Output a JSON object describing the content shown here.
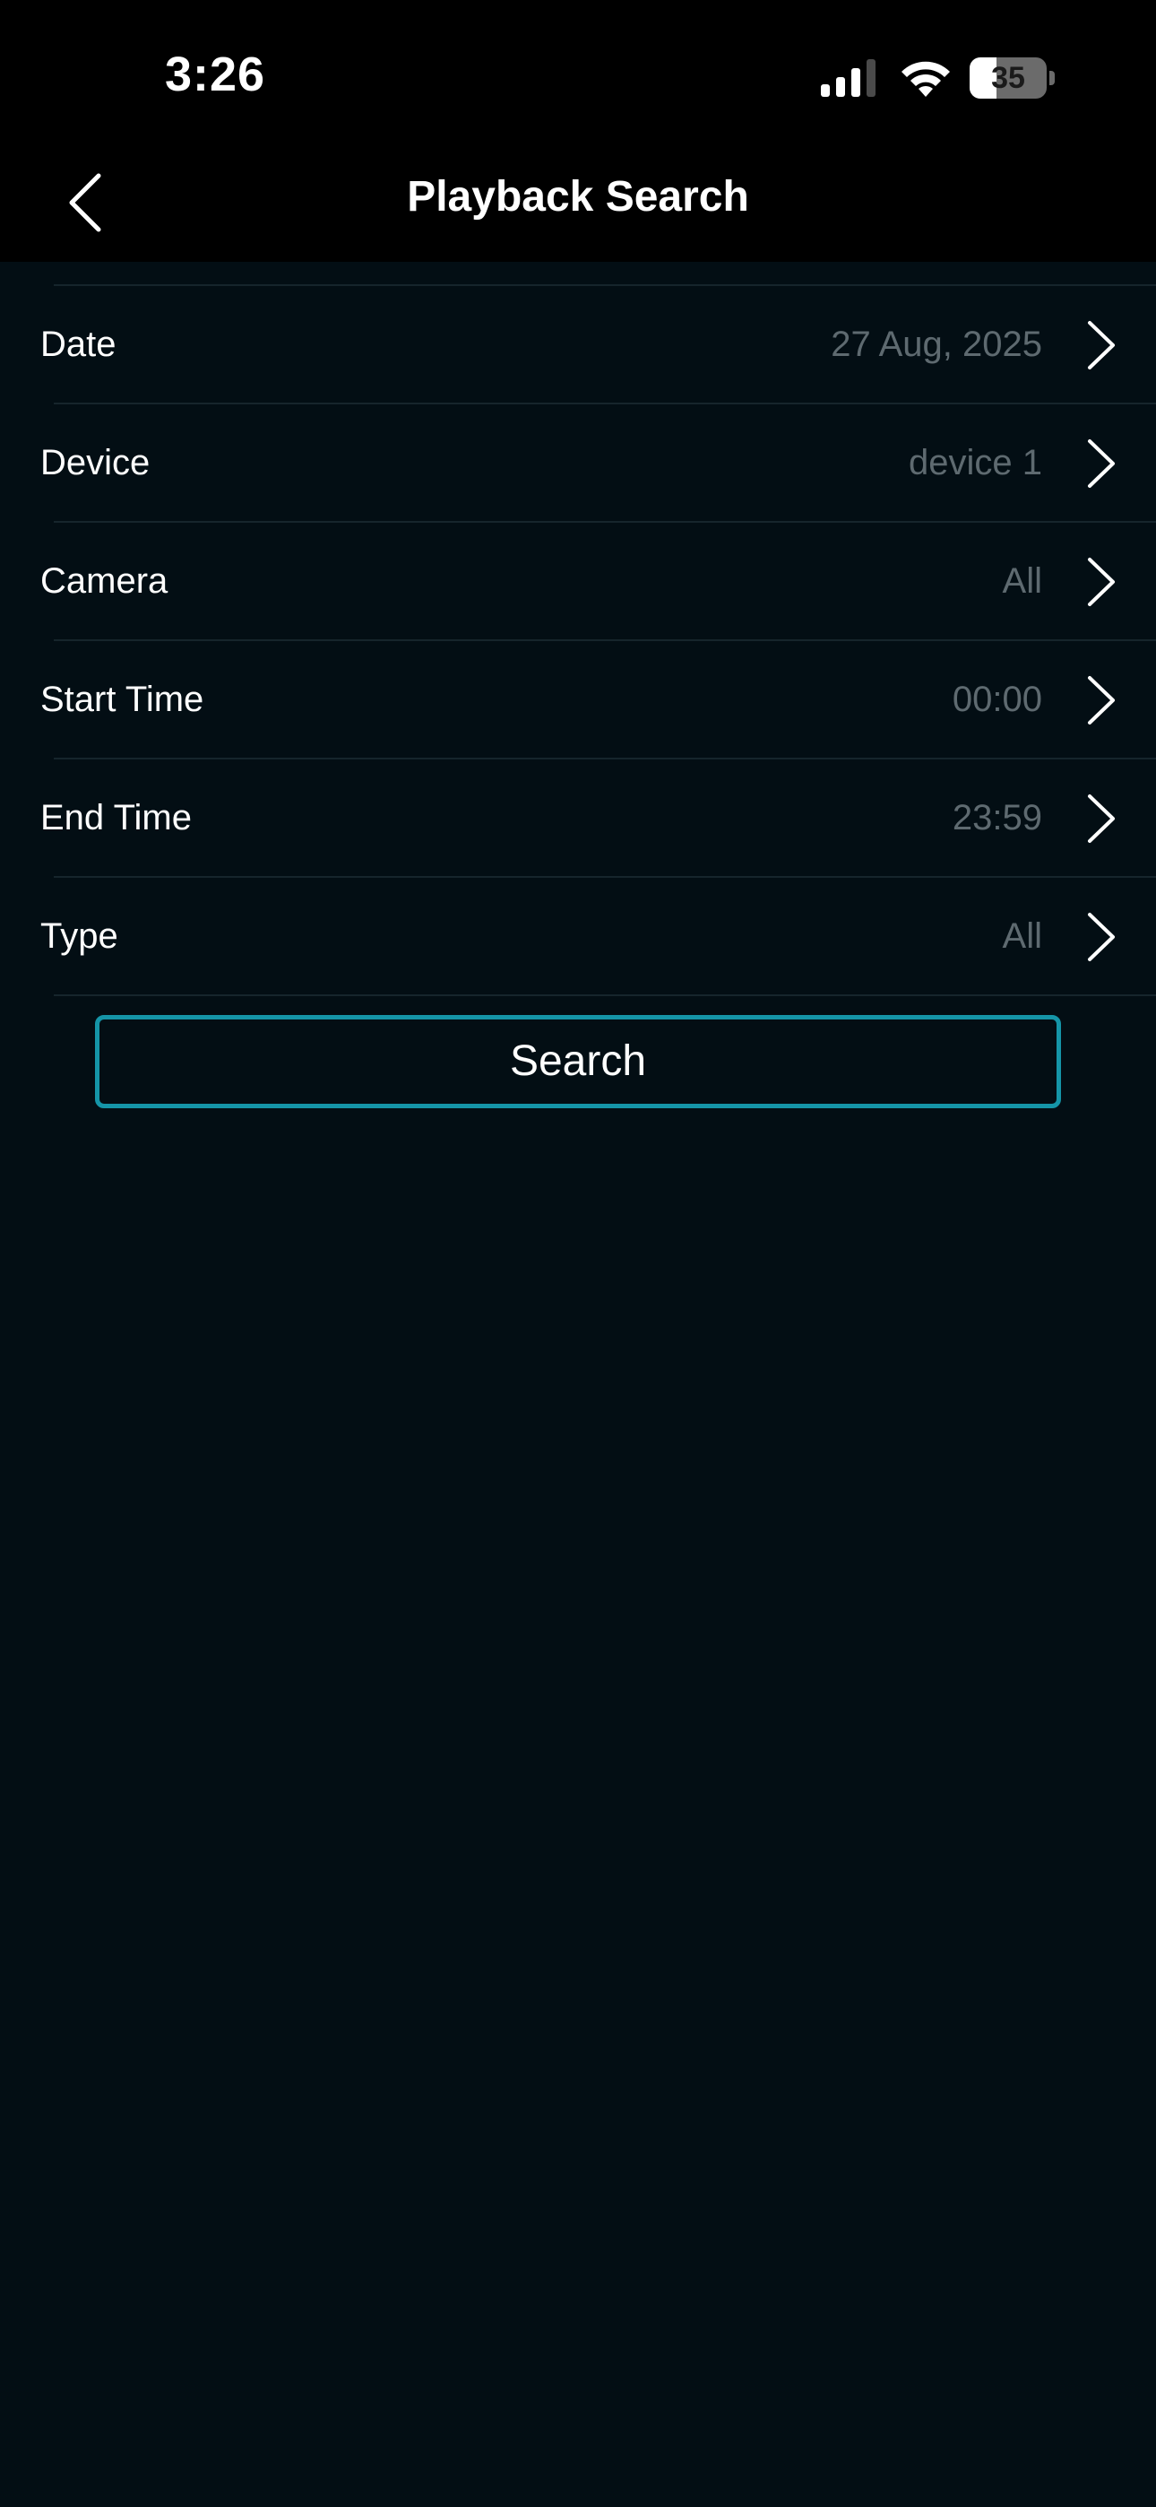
{
  "status_bar": {
    "time": "3:26",
    "battery_level": "35",
    "battery_fraction": 0.35,
    "signal_icon": "cellular-signal-icon",
    "wifi_icon": "wifi-icon",
    "battery_icon": "battery-icon"
  },
  "header": {
    "title": "Playback Search",
    "back_icon": "chevron-left-icon"
  },
  "rows": [
    {
      "label": "Date",
      "value": "27 Aug, 2025"
    },
    {
      "label": "Device",
      "value": "device 1"
    },
    {
      "label": "Camera",
      "value": "All"
    },
    {
      "label": "Start Time",
      "value": "00:00"
    },
    {
      "label": "End Time",
      "value": "23:59"
    },
    {
      "label": "Type",
      "value": "All"
    }
  ],
  "search_button": {
    "label": "Search"
  },
  "colors": {
    "background": "#030e14",
    "bar_background": "#000000",
    "accent": "#1595a8",
    "value_text": "#5e6a70",
    "divider": "#16252c"
  }
}
